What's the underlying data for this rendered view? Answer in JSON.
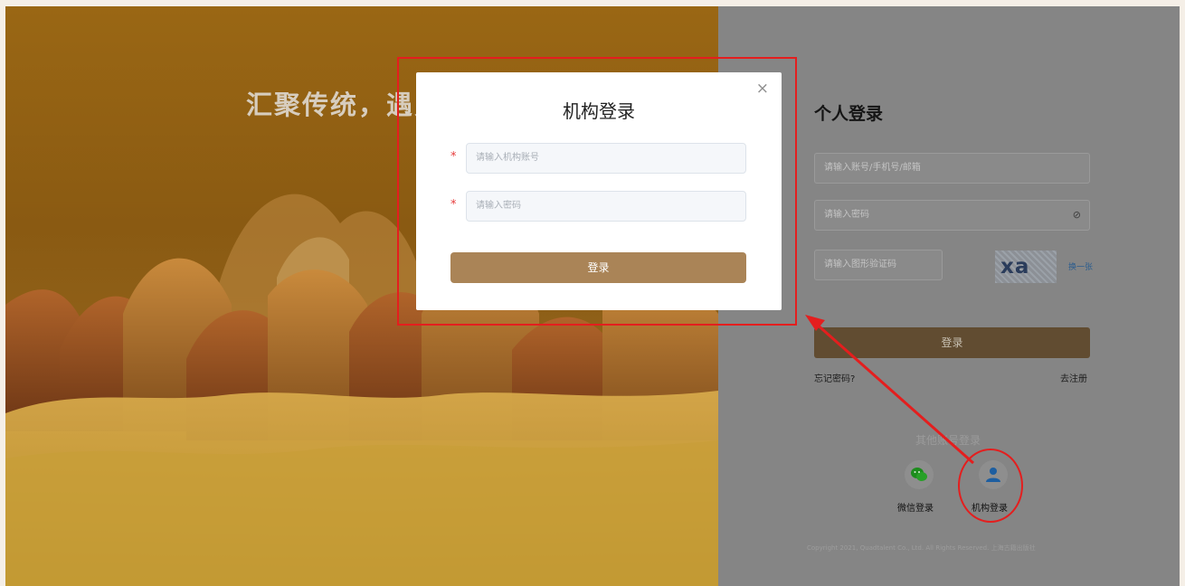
{
  "left_panel": {
    "slogan": "汇聚传统，遇见"
  },
  "personal_login": {
    "title": "个人登录",
    "account_placeholder": "请输入账号/手机号/邮箱",
    "password_placeholder": "请输入密码",
    "captcha_placeholder": "请输入图形验证码",
    "captcha_text": "xa",
    "swap_label": "换一张",
    "login_button": "登录",
    "forgot_password": "忘记密码?",
    "register": "去注册",
    "other_methods": "其他账号登录",
    "wechat_label": "微信登录",
    "org_label": "机构登录",
    "copyright": "Copyright 2021, Quadtalent Co., Ltd. All Rights Reserved. 上海古籍出版社"
  },
  "org_modal": {
    "title": "机构登录",
    "close_glyph": "×",
    "required_mark": "*",
    "account_placeholder": "请输入机构账号",
    "password_placeholder": "请输入密码",
    "login_button": "登录"
  },
  "annotations": {
    "color": "#e41e1e"
  },
  "colors": {
    "accent": "#aa8457",
    "overlay_gray": "#858585"
  },
  "icons": {
    "eye": "eye-off-icon",
    "wechat": "wechat-icon",
    "org": "user-icon",
    "close": "close-icon"
  }
}
